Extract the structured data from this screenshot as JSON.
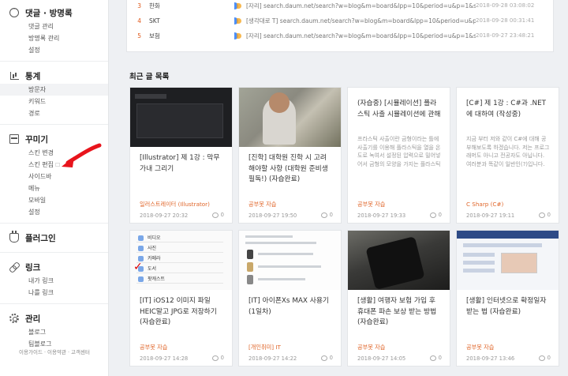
{
  "sidebar": {
    "sections": [
      {
        "title": "댓글 · 방명록",
        "icon": "chat-bubble-icon",
        "items": [
          "댓글 관리",
          "방명록 관리",
          "설정"
        ]
      },
      {
        "title": "통계",
        "icon": "bar-chart-icon",
        "items": [
          "방문자",
          "키워드",
          "경로"
        ]
      },
      {
        "title": "꾸미기",
        "icon": "layout-icon",
        "items": [
          "스킨 변경",
          "스킨 편집",
          "사이드바",
          "메뉴",
          "모바일",
          "설정"
        ]
      },
      {
        "title": "플러그인",
        "icon": "plug-icon",
        "items": []
      },
      {
        "title": "링크",
        "icon": "link-icon",
        "items": [
          "내가 링크",
          "나를 링크"
        ]
      },
      {
        "title": "관리",
        "icon": "gear-icon",
        "items": [
          "블로그",
          "팀블로그"
        ]
      }
    ],
    "skin_edit_ext": "☐",
    "footer": [
      "이용가이드",
      "이용약관",
      "고객센터"
    ]
  },
  "referrers": [
    {
      "rank": "3",
      "name": "한화",
      "url": "[자리] search.daum.net/search?w=blog&m=board&lpp=10&period=u&p=1&sor...",
      "time": "2018-09-28 03:08:02"
    },
    {
      "rank": "4",
      "name": "SKT",
      "url": "[생각대로 T] search.daum.net/search?w=blog&m=board&lpp=10&period=u&p=1&sor...",
      "time": "2018-09-28 00:31:41"
    },
    {
      "rank": "5",
      "name": "보험",
      "url": "[자리] search.daum.net/search?w=blog&m=board&lpp=10&period=u&p=1&sor...",
      "time": "2018-09-27 23:48:21"
    }
  ],
  "recent_posts_title": "최근 글 목록",
  "posts": [
    {
      "title": "[Illustrator] 제 1강 : 막무가내 그리기",
      "excerpt": "",
      "category": "일러스트레이터 (Illustrator)",
      "date": "2018-09-27 20:32",
      "comments": "0"
    },
    {
      "title": "[진학] 대학원 진학 시 고려해야할 사항 (대학원 준비생 필독!) (자습완료)",
      "excerpt": "",
      "category": "공부봇 자습",
      "date": "2018-09-27 19:50",
      "comments": "0"
    },
    {
      "title": "(자습중) [시뮬레이션] 플라스틱 사출 시뮬레이션에 관해",
      "excerpt": "프라스틱 사출이란 금형이라는 틀에 사출기를 이용해 플라스틱을 열을 온도로 녹여서 설정된 압력으로 밀어넣어서 금형의 모양을 가지는 플라스틱 사출물을 ...",
      "category": "공부봇 자습",
      "date": "2018-09-27 19:33",
      "comments": "0"
    },
    {
      "title": "[C#] 제 1강 : C#과 .NET에 대하여 (작성중)",
      "excerpt": "지금 부터 저와 같이 C#에 대해 공부해보도록 하겠습니다. 저는 프로그래머도 아니고 전공자도 아닙니다. 여러분과 똑같이 일반인(?)입니다. 저와 같이 공부한다...",
      "category": "C Sharp (C#)",
      "date": "2018-09-27 19:11",
      "comments": "0"
    },
    {
      "title": "[IT] iOS12 이미지 파일 HEIC말고 JPG로 저장하기 (자습완료)",
      "excerpt": "",
      "category": "공부봇 자습",
      "date": "2018-09-27 14:28",
      "comments": "0"
    },
    {
      "title": "[IT] 아이폰Xs MAX 사용기 (1일차)",
      "excerpt": "",
      "category": "[개인취미] IT",
      "date": "2018-09-27 14:22",
      "comments": "0"
    },
    {
      "title": "[생활] 여행자 보험 가입 후 휴대폰 파손 보상 받는 방법 (자습완료)",
      "excerpt": "",
      "category": "공부봇 자습",
      "date": "2018-09-27 14:05",
      "comments": "0"
    },
    {
      "title": "[생활] 인터넷으로 확정일자 받는 법 (자습완료)",
      "excerpt": "",
      "category": "공부봇 자습",
      "date": "2018-09-27 13:46",
      "comments": "0"
    }
  ],
  "thumb_list_rows": [
    "비디오",
    "사진",
    "카메라",
    "도서",
    "팟캐스트"
  ],
  "colors": {
    "accent": "#e05a1c",
    "arrow": "#e8141c"
  }
}
